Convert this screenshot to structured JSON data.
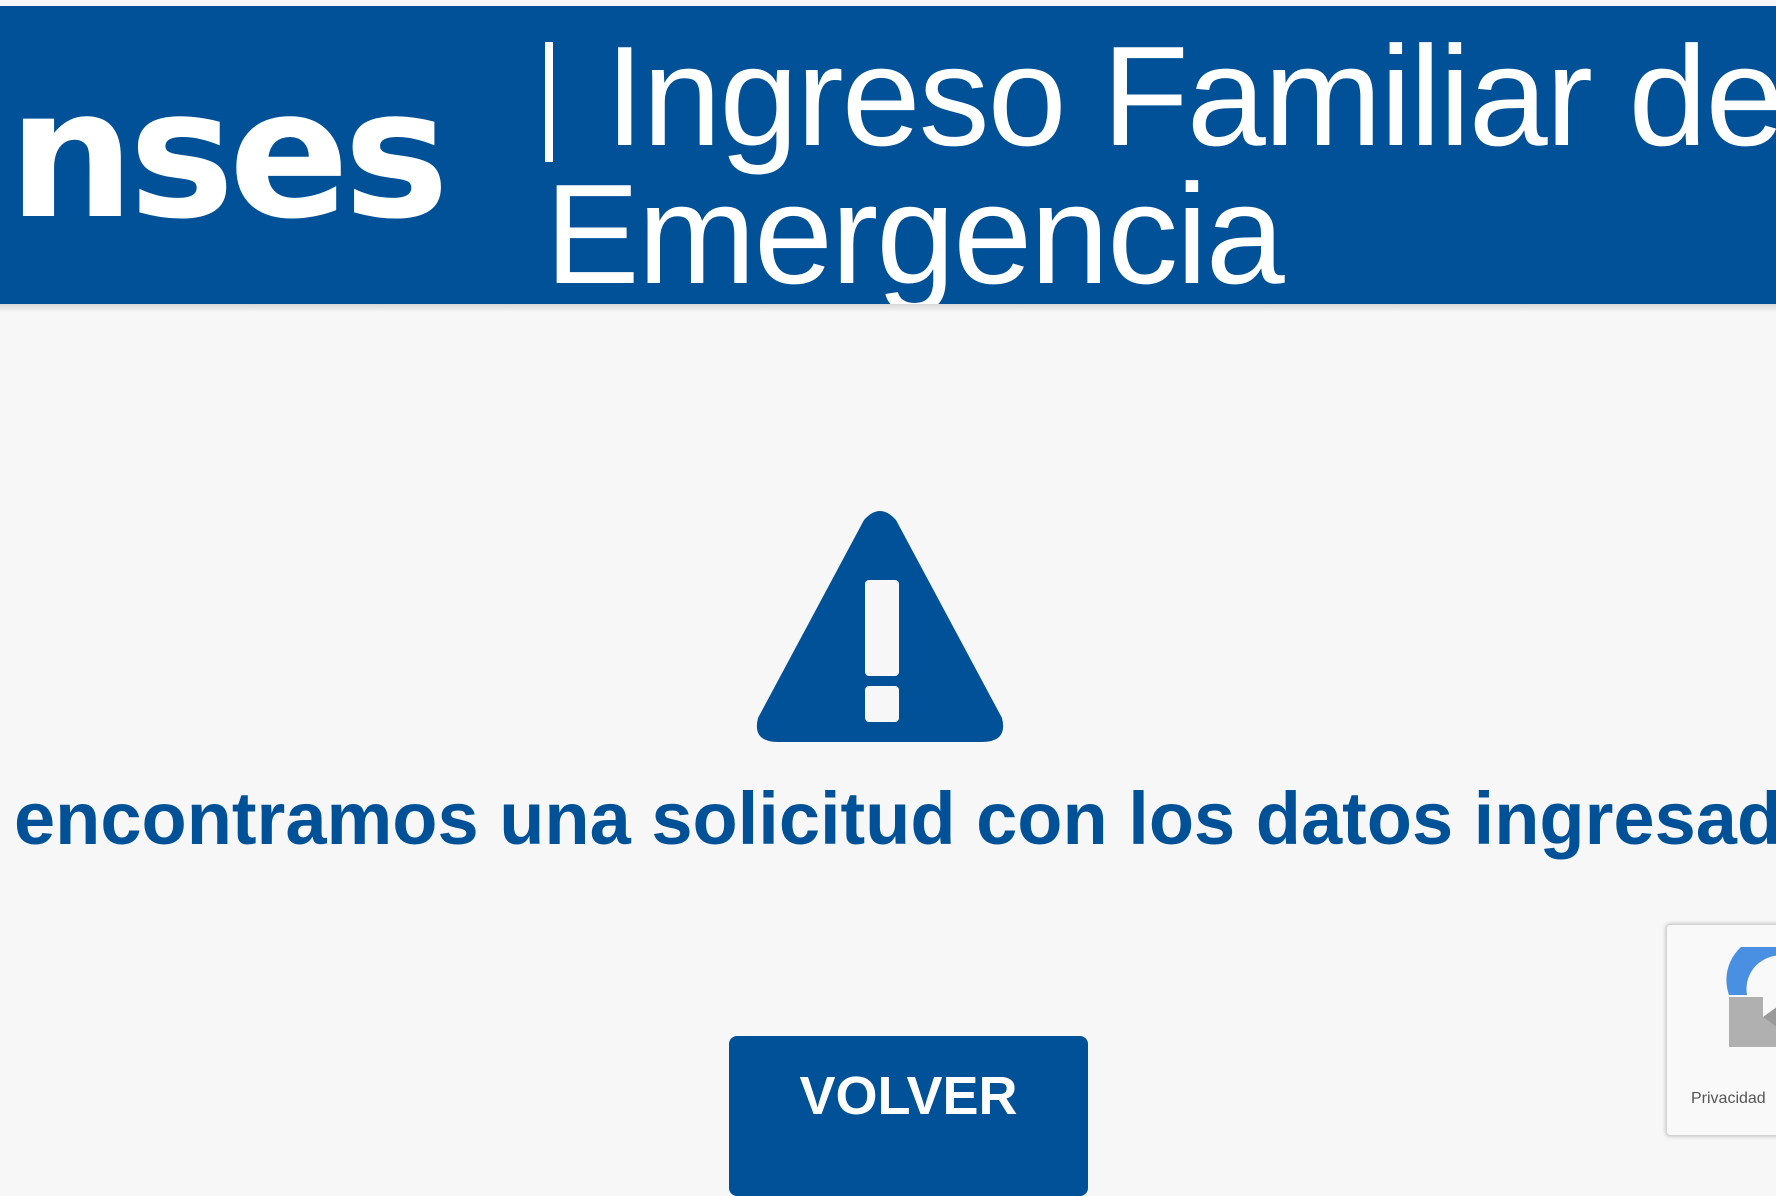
{
  "header": {
    "logo_text": "nses",
    "title_line1": "Ingreso Familiar de",
    "title_line2": "Emergencia"
  },
  "main": {
    "icon": "warning-icon",
    "message": "encontramos una solicitud con los datos ingresado",
    "back_button_label": "VOLVER"
  },
  "recaptcha": {
    "label": "Privacidad"
  },
  "colors": {
    "brand_blue": "#005197",
    "background": "#f7f7f7",
    "white": "#ffffff"
  }
}
